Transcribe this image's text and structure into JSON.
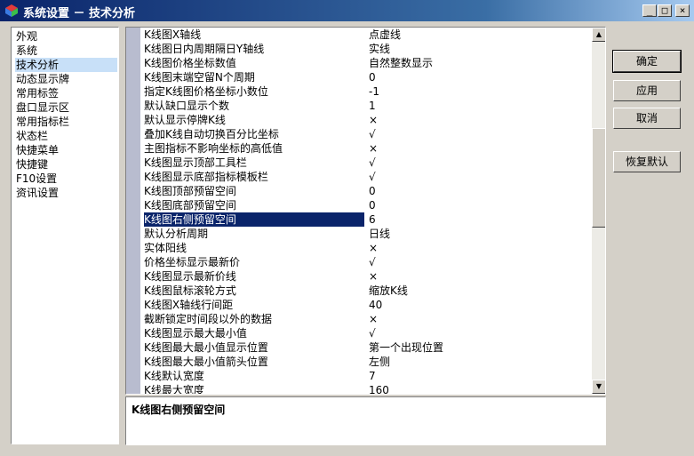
{
  "window": {
    "title": "系统设置 － 技术分析",
    "controls": {
      "minimize": "_",
      "maximize": "□",
      "close": "×"
    }
  },
  "nav": {
    "items": [
      {
        "label": "外观",
        "selected": false
      },
      {
        "label": "系统",
        "selected": false
      },
      {
        "label": "技术分析",
        "selected": true
      },
      {
        "label": "动态显示牌",
        "selected": false
      },
      {
        "label": "常用标签",
        "selected": false
      },
      {
        "label": "盘口显示区",
        "selected": false
      },
      {
        "label": "常用指标栏",
        "selected": false
      },
      {
        "label": "状态栏",
        "selected": false
      },
      {
        "label": "快捷菜单",
        "selected": false
      },
      {
        "label": "快捷键",
        "selected": false
      },
      {
        "label": "F10设置",
        "selected": false
      },
      {
        "label": "资讯设置",
        "selected": false
      }
    ]
  },
  "settings": {
    "rows": [
      {
        "key": "K线图X轴线",
        "value": "点虚线"
      },
      {
        "key": "K线图日内周期隔日Y轴线",
        "value": "实线"
      },
      {
        "key": "K线图价格坐标数值",
        "value": "自然整数显示"
      },
      {
        "key": "K线图末端空留N个周期",
        "value": "0"
      },
      {
        "key": "指定K线图价格坐标小数位",
        "value": "-1"
      },
      {
        "key": "默认缺口显示个数",
        "value": "1"
      },
      {
        "key": "默认显示停牌K线",
        "value": "×"
      },
      {
        "key": "叠加K线自动切换百分比坐标",
        "value": "√"
      },
      {
        "key": "主图指标不影响坐标的高低值",
        "value": "×"
      },
      {
        "key": "K线图显示顶部工具栏",
        "value": "√"
      },
      {
        "key": "K线图显示底部指标模板栏",
        "value": "√"
      },
      {
        "key": "K线图顶部预留空间",
        "value": "0"
      },
      {
        "key": "K线图底部预留空间",
        "value": "0"
      },
      {
        "key": "K线图右侧预留空间",
        "value": "6",
        "selected": true
      },
      {
        "key": "默认分析周期",
        "value": "日线"
      },
      {
        "key": "实体阳线",
        "value": "×"
      },
      {
        "key": "价格坐标显示最新价",
        "value": "√"
      },
      {
        "key": "K线图显示最新价线",
        "value": "×"
      },
      {
        "key": "K线图鼠标滚轮方式",
        "value": "缩放K线"
      },
      {
        "key": "K线图X轴线行间距",
        "value": "40"
      },
      {
        "key": "截断锁定时间段以外的数据",
        "value": "×"
      },
      {
        "key": "K线图显示最大最小值",
        "value": "√"
      },
      {
        "key": "K线图最大最小值显示位置",
        "value": "第一个出现位置"
      },
      {
        "key": "K线图最大最小值箭头位置",
        "value": "左侧"
      },
      {
        "key": "K线默认宽度",
        "value": "7"
      },
      {
        "key": "K线最大宽度",
        "value": "160"
      }
    ],
    "scroll_up": "▲",
    "scroll_down": "▼"
  },
  "description": "K线图右侧预留空间",
  "buttons": {
    "ok": "确定",
    "apply": "应用",
    "cancel": "取消",
    "reset": "恢复默认"
  },
  "colors": {
    "title_bar": "#0a246a",
    "selection": "#0a246a",
    "nav_selection": "#c8e0f8",
    "gutter": "#b8bccf"
  }
}
